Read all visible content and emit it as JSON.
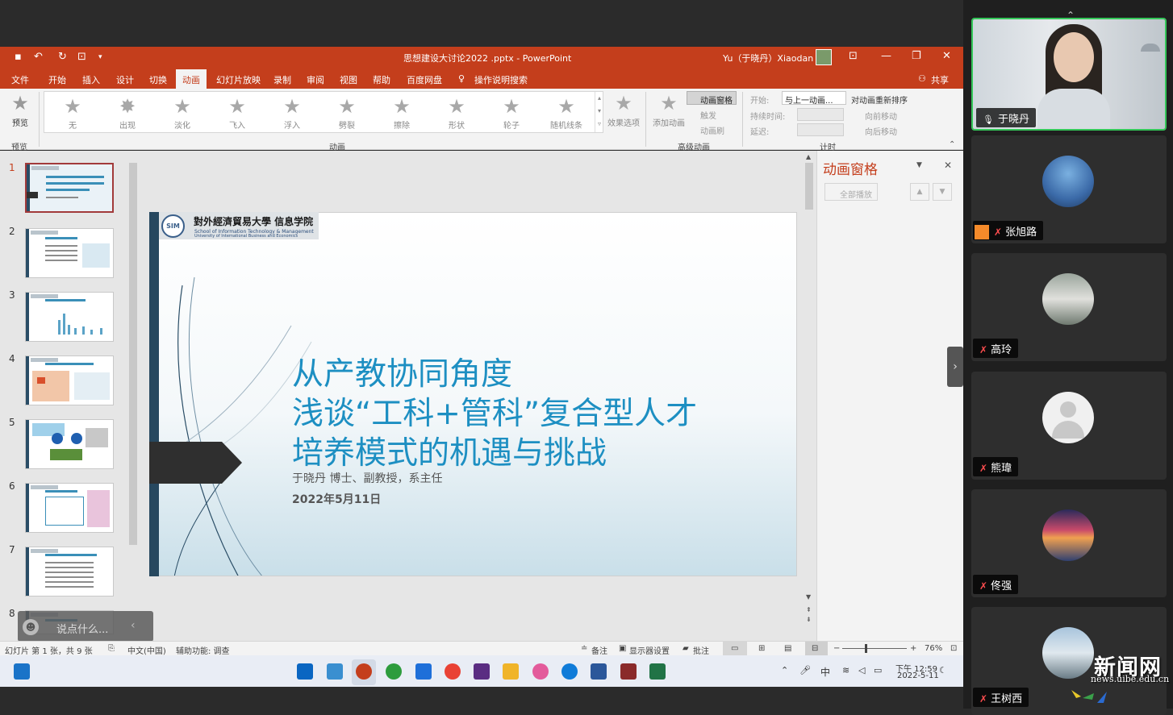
{
  "app": {
    "title": "思想建设大讨论2022 .pptx  -  PowerPoint",
    "user": "Yu（于晓丹）Xiaodan"
  },
  "menu": {
    "items": [
      "文件",
      "开始",
      "插入",
      "设计",
      "切换",
      "动画",
      "幻灯片放映",
      "录制",
      "审阅",
      "视图",
      "帮助",
      "百度网盘"
    ],
    "active": "动画",
    "search": "操作说明搜索",
    "share": "共享"
  },
  "ribbon": {
    "preview": "预览",
    "preview_group": "预览",
    "animations": [
      "无",
      "出现",
      "淡化",
      "飞入",
      "浮入",
      "劈裂",
      "擦除",
      "形状",
      "轮子",
      "随机线条"
    ],
    "effect_options": "效果选项",
    "animation_group": "动画",
    "add_animation": "添加动画",
    "animation_pane_btn": "动画窗格",
    "trigger": "触发",
    "animation_painter": "动画刷",
    "advanced_group": "高级动画",
    "start_label": "开始:",
    "start_value": "与上一动画...",
    "duration_label": "持续时间:",
    "delay_label": "延迟:",
    "reorder": "对动画重新排序",
    "move_earlier": "向前移动",
    "move_later": "向后移动",
    "timing_group": "计时"
  },
  "thumbnails": [
    "1",
    "2",
    "3",
    "4",
    "5",
    "6",
    "7",
    "8"
  ],
  "slide": {
    "logo_seal": "SIM",
    "logo_cn": "對外經濟貿易大學  信息学院",
    "logo_en1": "School of Information Technology & Management",
    "logo_en2": "University of International Business and Economics",
    "title_lines": [
      "从产教协同角度",
      "浅谈“工科+管科”复合型人才",
      "培养模式的机遇与挑战"
    ],
    "subtitle": "于晓丹 博士、副教授，系主任",
    "date": "2022年5月11日"
  },
  "anim_pane": {
    "title": "动画窗格",
    "play_all": "全部播放"
  },
  "chat": {
    "placeholder": "说点什么..."
  },
  "status": {
    "slide_info": "幻灯片 第 1 张，共 9 张",
    "language": "中文(中国)",
    "accessibility": "辅助功能: 调查",
    "notes": "备注",
    "display": "显示器设置",
    "comments": "批注",
    "zoom": "76%"
  },
  "taskbar": {
    "ime": "中",
    "time": "下午 12:59",
    "date": "2022-5-11"
  },
  "participants": [
    {
      "name": "于晓丹"
    },
    {
      "name": "张旭路"
    },
    {
      "name": "高玲"
    },
    {
      "name": "熊瑋"
    },
    {
      "name": "佟强"
    },
    {
      "name": "王树西"
    }
  ],
  "watermark": {
    "cn": "新闻网",
    "url": "news.uibe.edu.cn"
  }
}
